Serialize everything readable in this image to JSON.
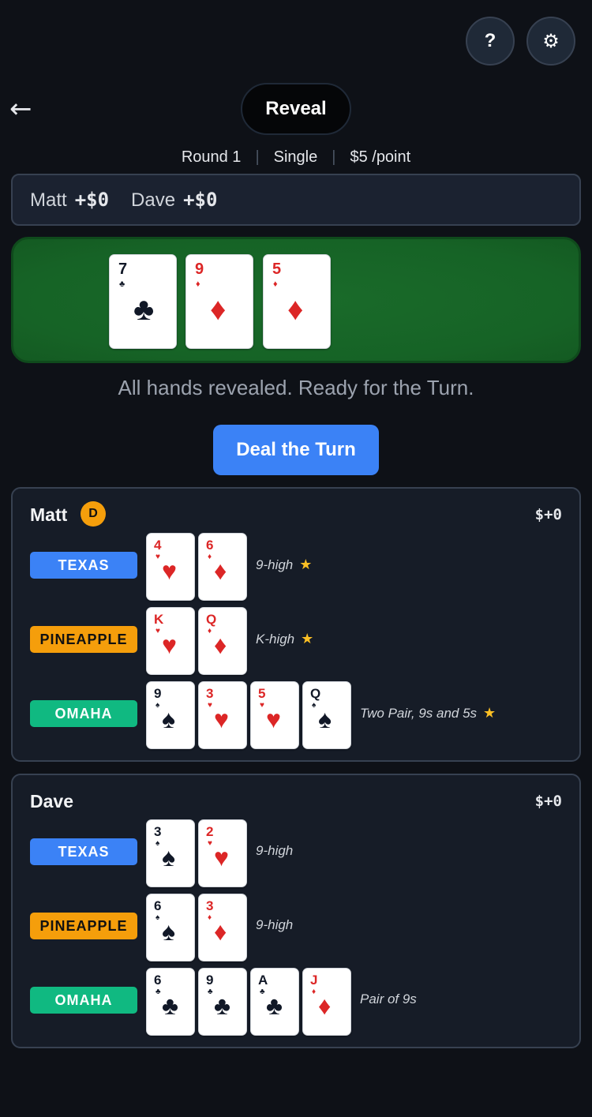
{
  "header": {
    "help_label": "?",
    "settings_icon": "gear-icon",
    "settings_glyph": "⚙",
    "back_icon": "back-arrow-icon",
    "back_glyph": "←",
    "phase": "Reveal"
  },
  "meta": {
    "round": "Round 1",
    "mode": "Single",
    "stake": "$5 /point",
    "separator": "|"
  },
  "scores": [
    {
      "name": "Matt",
      "amount": "+$0"
    },
    {
      "name": "Dave",
      "amount": "+$0"
    }
  ],
  "board": [
    {
      "rank": "7",
      "suit": "♣",
      "color": "black"
    },
    {
      "rank": "9",
      "suit": "♦",
      "color": "red"
    },
    {
      "rank": "5",
      "suit": "♦",
      "color": "red"
    }
  ],
  "status": "All hands revealed. Ready for the Turn.",
  "deal_button": "Deal the Turn",
  "players": [
    {
      "name": "Matt",
      "dealer_badge": "D",
      "total": "$+0",
      "hands": [
        {
          "game": "TEXAS",
          "type": "texas",
          "cards": [
            {
              "rank": "4",
              "suit": "♥",
              "color": "red"
            },
            {
              "rank": "6",
              "suit": "♦",
              "color": "red"
            }
          ],
          "desc": "9-high",
          "star": "★"
        },
        {
          "game": "PINEAPPLE",
          "type": "pineapple",
          "cards": [
            {
              "rank": "K",
              "suit": "♥",
              "color": "red"
            },
            {
              "rank": "Q",
              "suit": "♦",
              "color": "red"
            }
          ],
          "desc": "K-high",
          "star": "★"
        },
        {
          "game": "OMAHA",
          "type": "omaha",
          "cards": [
            {
              "rank": "9",
              "suit": "♠",
              "color": "black"
            },
            {
              "rank": "3",
              "suit": "♥",
              "color": "red"
            },
            {
              "rank": "5",
              "suit": "♥",
              "color": "red"
            },
            {
              "rank": "Q",
              "suit": "♠",
              "color": "black"
            }
          ],
          "desc": "Two Pair, 9s and 5s",
          "star": "★"
        }
      ]
    },
    {
      "name": "Dave",
      "dealer_badge": "",
      "total": "$+0",
      "hands": [
        {
          "game": "TEXAS",
          "type": "texas",
          "cards": [
            {
              "rank": "3",
              "suit": "♠",
              "color": "black"
            },
            {
              "rank": "2",
              "suit": "♥",
              "color": "red"
            }
          ],
          "desc": "9-high",
          "star": ""
        },
        {
          "game": "PINEAPPLE",
          "type": "pineapple",
          "cards": [
            {
              "rank": "6",
              "suit": "♠",
              "color": "black"
            },
            {
              "rank": "3",
              "suit": "♦",
              "color": "red"
            }
          ],
          "desc": "9-high",
          "star": ""
        },
        {
          "game": "OMAHA",
          "type": "omaha",
          "cards": [
            {
              "rank": "6",
              "suit": "♣",
              "color": "black"
            },
            {
              "rank": "9",
              "suit": "♣",
              "color": "black"
            },
            {
              "rank": "A",
              "suit": "♣",
              "color": "black"
            },
            {
              "rank": "J",
              "suit": "♦",
              "color": "red"
            }
          ],
          "desc": "Pair of 9s",
          "star": ""
        }
      ]
    }
  ],
  "colors": {
    "background": "#0e1117",
    "felt": "#166326",
    "primary": "#3b82f6",
    "texas": "#3b82f6",
    "pineapple": "#f59e0b",
    "omaha": "#10b981",
    "star": "#fbbf24",
    "red_suit": "#dc2626"
  }
}
